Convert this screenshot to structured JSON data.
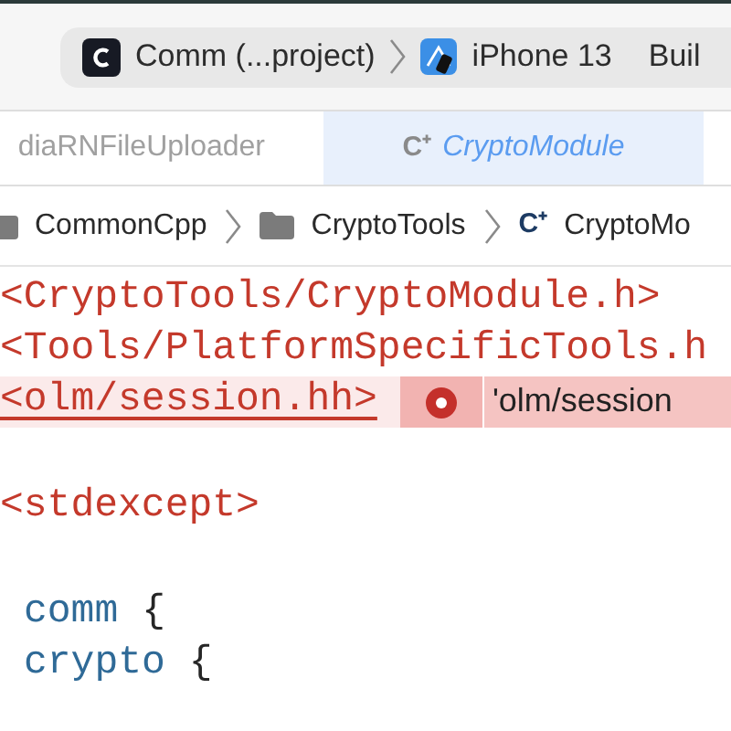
{
  "toolbar": {
    "scheme": {
      "project": "Comm (...project)",
      "device": "iPhone 13",
      "status": "Buil"
    }
  },
  "tabs": [
    {
      "label": "diaRNFileUploader",
      "selected": false,
      "kind": "plain"
    },
    {
      "label": "CryptoModule",
      "selected": true,
      "kind": "cpp",
      "icon": "C⁺"
    }
  ],
  "breadcrumb": [
    {
      "label": "CommonCpp",
      "kind": "folder"
    },
    {
      "label": "CryptoTools",
      "kind": "folder"
    },
    {
      "label": "CryptoMo",
      "kind": "cpp",
      "icon": "C⁺"
    }
  ],
  "editor": {
    "lines": [
      {
        "kind": "code",
        "tokens": [
          {
            "text": "<CryptoTools/CryptoModule.h>",
            "kind": "string"
          }
        ]
      },
      {
        "kind": "code",
        "tokens": [
          {
            "text": "<Tools/PlatformSpecificTools.h",
            "kind": "string"
          }
        ]
      },
      {
        "kind": "error",
        "tokens": [
          {
            "text": "<olm/session.hh>",
            "kind": "string"
          }
        ],
        "message": "'olm/session"
      },
      {
        "kind": "blank"
      },
      {
        "kind": "code",
        "tokens": [
          {
            "text": "<stdexcept>",
            "kind": "string"
          }
        ]
      },
      {
        "kind": "blank"
      },
      {
        "kind": "scope",
        "tokens": [
          {
            "text": "comm",
            "kind": "name"
          },
          {
            "text": "{",
            "kind": "punct"
          }
        ]
      },
      {
        "kind": "scope",
        "tokens": [
          {
            "text": "crypto",
            "kind": "name"
          },
          {
            "text": "{",
            "kind": "punct"
          }
        ]
      }
    ]
  }
}
